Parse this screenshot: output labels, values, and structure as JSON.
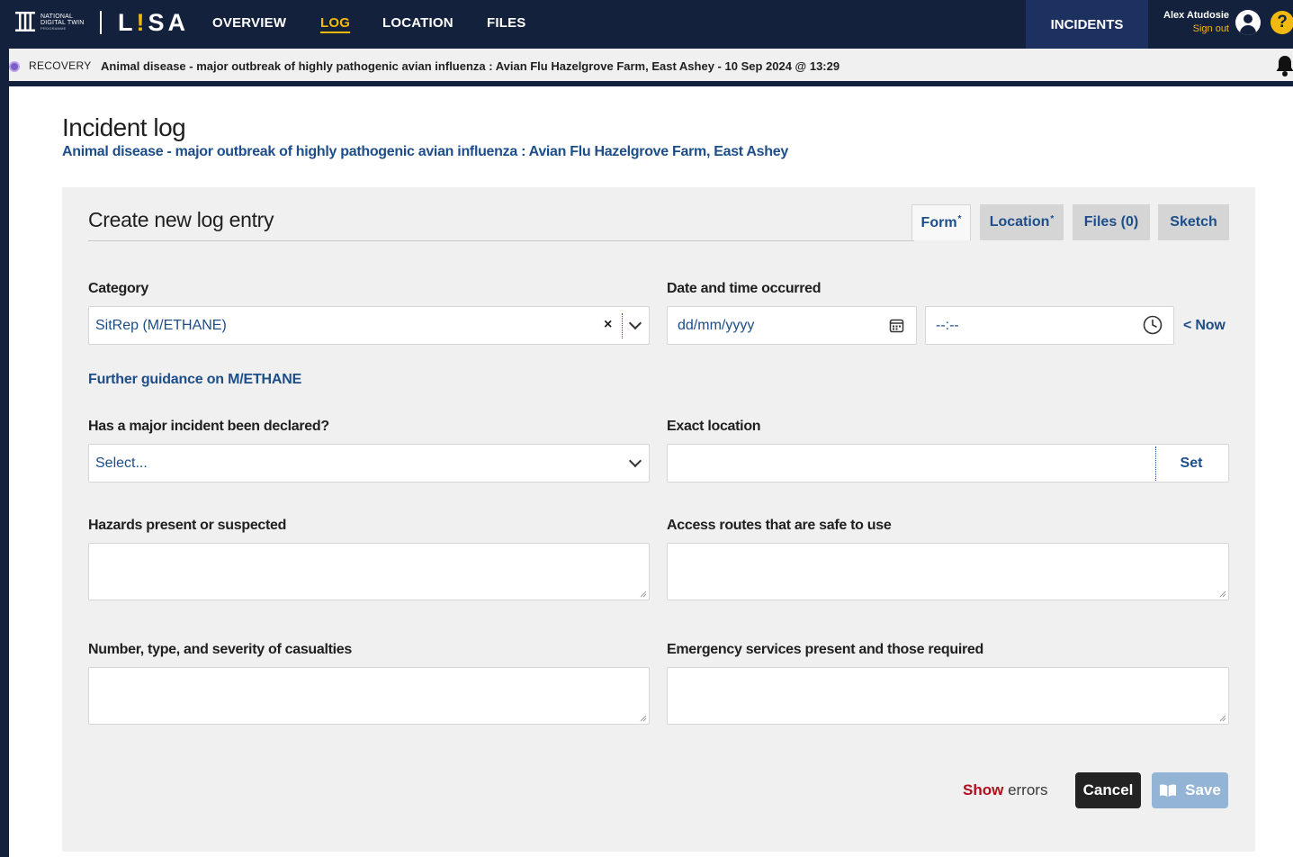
{
  "brand": {
    "org_line1": "NATIONAL",
    "org_line2": "DIGITAL TWIN",
    "org_line3": "PROGRAMME",
    "app_name_pre": "L",
    "app_name_bang": "!",
    "app_name_post": "SA"
  },
  "nav": {
    "items": [
      {
        "label": "OVERVIEW",
        "active": false
      },
      {
        "label": "LOG",
        "active": true
      },
      {
        "label": "LOCATION",
        "active": false
      },
      {
        "label": "FILES",
        "active": false
      }
    ],
    "incidents_label": "INCIDENTS"
  },
  "user": {
    "name": "Alex Atudosie",
    "sign_out": "Sign out",
    "help_label": "?"
  },
  "status_strip": {
    "phase": "RECOVERY",
    "incident": "Animal disease - major outbreak of highly pathogenic avian influenza : Avian Flu Hazelgrove Farm, East Ashey - 10 Sep 2024 @ 13:29"
  },
  "page": {
    "title": "Incident log",
    "subtitle": "Animal disease - major outbreak of highly pathogenic avian influenza : Avian Flu Hazelgrove Farm, East Ashey"
  },
  "form": {
    "title": "Create new log entry",
    "tabs": [
      {
        "label": "Form",
        "marker": "*",
        "active": true
      },
      {
        "label": "Location",
        "marker": "*",
        "active": false
      },
      {
        "label": "Files (0)",
        "marker": "",
        "active": false
      },
      {
        "label": "Sketch",
        "marker": "",
        "active": false
      }
    ],
    "category": {
      "label": "Category",
      "value": "SitRep (M/ETHANE)",
      "clear": "×"
    },
    "datetime": {
      "label": "Date and time occurred",
      "date_placeholder": "dd/mm/yyyy",
      "time_placeholder": "--:--",
      "now_link": "< Now"
    },
    "guidance_link": "Further guidance on M/ETHANE",
    "major_incident": {
      "label": "Has a major incident been declared?",
      "value": "Select..."
    },
    "exact_location": {
      "label": "Exact location",
      "value": "",
      "set_button": "Set"
    },
    "hazards": {
      "label": "Hazards present or suspected",
      "value": ""
    },
    "access_routes": {
      "label": "Access routes that are safe to use",
      "value": ""
    },
    "casualties": {
      "label": "Number, type, and severity of casualties",
      "value": ""
    },
    "emergency_services": {
      "label": "Emergency services present and those required",
      "value": ""
    },
    "actions": {
      "show_errors_kw": "Show",
      "show_errors_rest": " errors",
      "cancel": "Cancel",
      "save": "Save"
    }
  },
  "colors": {
    "nav_bg": "#13213d",
    "accent_yellow": "#f2b90f",
    "link_blue": "#1d4e89",
    "error_red": "#b10e1e",
    "recovery_purple": "#7c5cc7",
    "save_disabled": "#94b4d6"
  },
  "icons": {
    "calendar": "calendar-icon",
    "clock": "clock-icon",
    "bell": "bell-icon",
    "user": "user-icon",
    "book": "book-icon"
  }
}
